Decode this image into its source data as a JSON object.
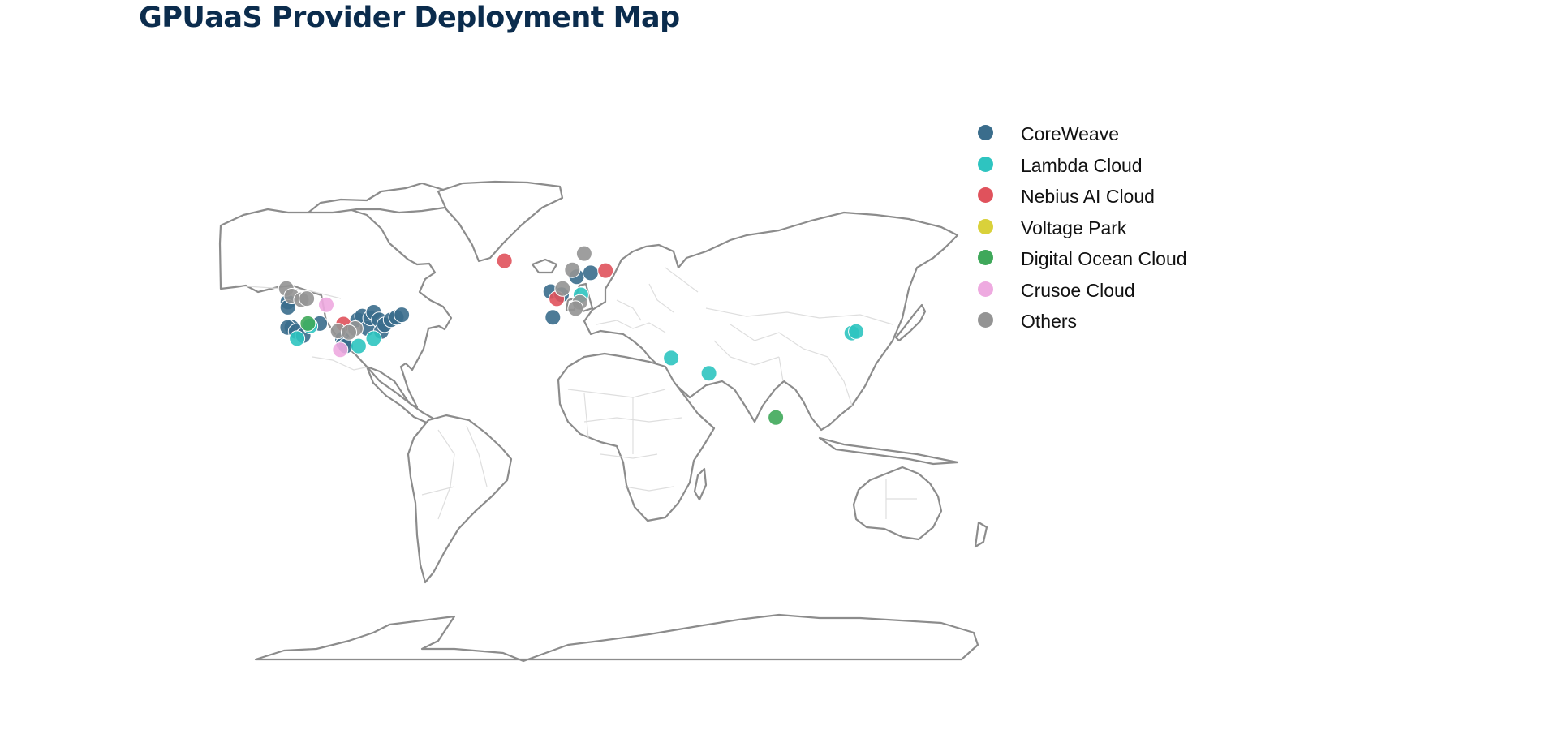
{
  "page": {
    "title": "GPUaaS Provider Deployment Map"
  },
  "colors": {
    "title": "#0b2c4d",
    "coastline": "#8c8c8c",
    "border": "#dedede",
    "land": "#ffffff"
  },
  "legend": [
    {
      "label": "CoreWeave",
      "color": "#3a6d8c"
    },
    {
      "label": "Lambda Cloud",
      "color": "#2ec4c0"
    },
    {
      "label": "Nebius AI Cloud",
      "color": "#e0525c"
    },
    {
      "label": "Voltage Park",
      "color": "#d9d13a"
    },
    {
      "label": "Digital Ocean Cloud",
      "color": "#3fa85a"
    },
    {
      "label": "Crusoe Cloud",
      "color": "#eeaae0"
    },
    {
      "label": "Others",
      "color": "#949494"
    }
  ],
  "map": {
    "projection": "equirectangular",
    "locations": [
      {
        "provider": "CoreWeave",
        "lon": -122.3,
        "lat": 47.6
      },
      {
        "provider": "CoreWeave",
        "lon": -122.3,
        "lat": 45.5
      },
      {
        "provider": "CoreWeave",
        "lon": -120.5,
        "lat": 37.5
      },
      {
        "provider": "CoreWeave",
        "lon": -122.4,
        "lat": 37.4
      },
      {
        "provider": "CoreWeave",
        "lon": -118.5,
        "lat": 35.8
      },
      {
        "provider": "CoreWeave",
        "lon": -115.2,
        "lat": 34.2
      },
      {
        "provider": "CoreWeave",
        "lon": -107.5,
        "lat": 39.0
      },
      {
        "provider": "CoreWeave",
        "lon": -97.0,
        "lat": 32.8
      },
      {
        "provider": "CoreWeave",
        "lon": -96.5,
        "lat": 31.0
      },
      {
        "provider": "CoreWeave",
        "lon": -95.5,
        "lat": 30.0
      },
      {
        "provider": "CoreWeave",
        "lon": -90.0,
        "lat": 40.5
      },
      {
        "provider": "CoreWeave",
        "lon": -87.8,
        "lat": 42.0
      },
      {
        "provider": "CoreWeave",
        "lon": -85.5,
        "lat": 37.0
      },
      {
        "provider": "CoreWeave",
        "lon": -84.0,
        "lat": 41.2
      },
      {
        "provider": "CoreWeave",
        "lon": -82.5,
        "lat": 43.5
      },
      {
        "provider": "CoreWeave",
        "lon": -80.0,
        "lat": 40.5
      },
      {
        "provider": "CoreWeave",
        "lon": -79.0,
        "lat": 35.8
      },
      {
        "provider": "CoreWeave",
        "lon": -77.5,
        "lat": 38.5
      },
      {
        "provider": "CoreWeave",
        "lon": -74.5,
        "lat": 40.5
      },
      {
        "provider": "CoreWeave",
        "lon": -72.0,
        "lat": 41.5
      },
      {
        "provider": "CoreWeave",
        "lon": -69.5,
        "lat": 42.5
      },
      {
        "provider": "CoreWeave",
        "lon": -0.5,
        "lat": 51.8
      },
      {
        "provider": "CoreWeave",
        "lon": 4.5,
        "lat": 50.6
      },
      {
        "provider": "CoreWeave",
        "lon": 0.5,
        "lat": 41.5
      },
      {
        "provider": "CoreWeave",
        "lon": 11.5,
        "lat": 57.7
      },
      {
        "provider": "CoreWeave",
        "lon": 18.0,
        "lat": 59.3
      },
      {
        "provider": "Lambda Cloud",
        "lon": 13.5,
        "lat": 50.5
      },
      {
        "provider": "Lambda Cloud",
        "lon": -112.0,
        "lat": 38.0
      },
      {
        "provider": "Lambda Cloud",
        "lon": -118.0,
        "lat": 33.0
      },
      {
        "provider": "Lambda Cloud",
        "lon": -82.5,
        "lat": 33.0
      },
      {
        "provider": "Lambda Cloud",
        "lon": -89.5,
        "lat": 30.0
      },
      {
        "provider": "Lambda Cloud",
        "lon": 55.3,
        "lat": 25.2
      },
      {
        "provider": "Lambda Cloud",
        "lon": 72.8,
        "lat": 19.1
      },
      {
        "provider": "Lambda Cloud",
        "lon": 139.0,
        "lat": 35.2
      },
      {
        "provider": "Lambda Cloud",
        "lon": 141.0,
        "lat": 35.8
      },
      {
        "provider": "Nebius AI Cloud",
        "lon": -21.9,
        "lat": 64.1
      },
      {
        "provider": "Nebius AI Cloud",
        "lon": 24.9,
        "lat": 60.2
      },
      {
        "provider": "Nebius AI Cloud",
        "lon": 2.3,
        "lat": 48.9
      },
      {
        "provider": "Nebius AI Cloud",
        "lon": -96.5,
        "lat": 38.8
      },
      {
        "provider": "Digital Ocean Cloud",
        "lon": -113.0,
        "lat": 39.0
      },
      {
        "provider": "Digital Ocean Cloud",
        "lon": 103.8,
        "lat": 1.35
      },
      {
        "provider": "Crusoe Cloud",
        "lon": -104.5,
        "lat": 46.5
      },
      {
        "provider": "Crusoe Cloud",
        "lon": -98.0,
        "lat": 28.5
      },
      {
        "provider": "Others",
        "lon": -123.0,
        "lat": 53.0
      },
      {
        "provider": "Others",
        "lon": -120.5,
        "lat": 50.0
      },
      {
        "provider": "Others",
        "lon": -116.0,
        "lat": 48.5
      },
      {
        "provider": "Others",
        "lon": -113.5,
        "lat": 49.0
      },
      {
        "provider": "Others",
        "lon": -99.0,
        "lat": 36.0
      },
      {
        "provider": "Others",
        "lon": -91.0,
        "lat": 37.0
      },
      {
        "provider": "Others",
        "lon": -94.0,
        "lat": 35.5
      },
      {
        "provider": "Others",
        "lon": 15.0,
        "lat": 67.0
      },
      {
        "provider": "Others",
        "lon": 9.5,
        "lat": 60.5
      },
      {
        "provider": "Others",
        "lon": 13.0,
        "lat": 47.5
      },
      {
        "provider": "Others",
        "lon": 11.0,
        "lat": 45.0
      },
      {
        "provider": "Others",
        "lon": 5.0,
        "lat": 53.0
      }
    ]
  }
}
